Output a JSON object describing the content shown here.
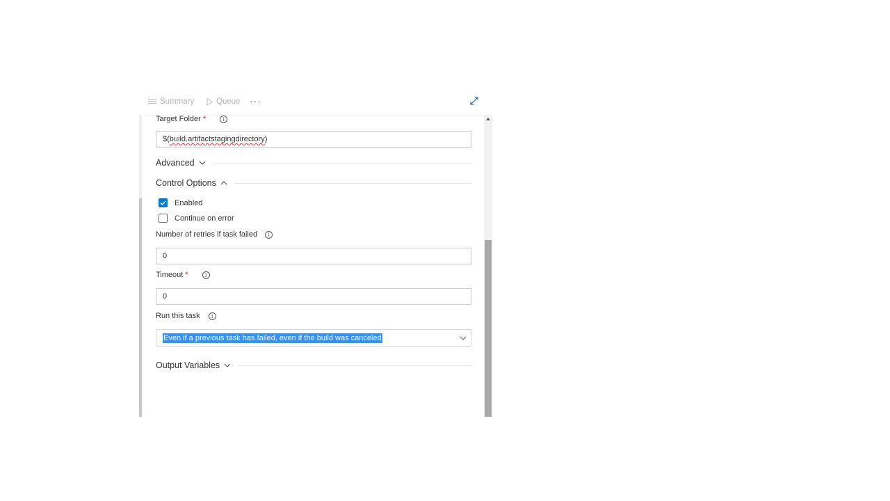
{
  "toolbar": {
    "summary_label": "Summary",
    "queue_label": "Queue",
    "more_label": "···"
  },
  "form": {
    "target_folder": {
      "label": "Target Folder",
      "required_mark": "*",
      "value": "$(build.artifactstagingdirectory)",
      "value_prefix": "$(",
      "value_squiggle": "build.artifactstagingdirectory",
      "value_suffix": ")"
    },
    "advanced": {
      "title": "Advanced",
      "expanded": false
    },
    "control_options": {
      "title": "Control Options",
      "expanded": true,
      "enabled": {
        "label": "Enabled",
        "checked": true
      },
      "continue_on_error": {
        "label": "Continue on error",
        "checked": false
      },
      "retries": {
        "label": "Number of retries if task failed",
        "value": "0"
      },
      "timeout": {
        "label": "Timeout",
        "required_mark": "*",
        "value": "0"
      },
      "run_this_task": {
        "label": "Run this task",
        "selected": "Even if a previous task has failed, even if the build was canceled"
      }
    },
    "output_variables": {
      "title": "Output Variables",
      "expanded": false
    }
  },
  "icons": {
    "info": "i"
  },
  "colors": {
    "accent": "#0078d4",
    "selection": "#3390ff",
    "required": "#c50f1f"
  }
}
